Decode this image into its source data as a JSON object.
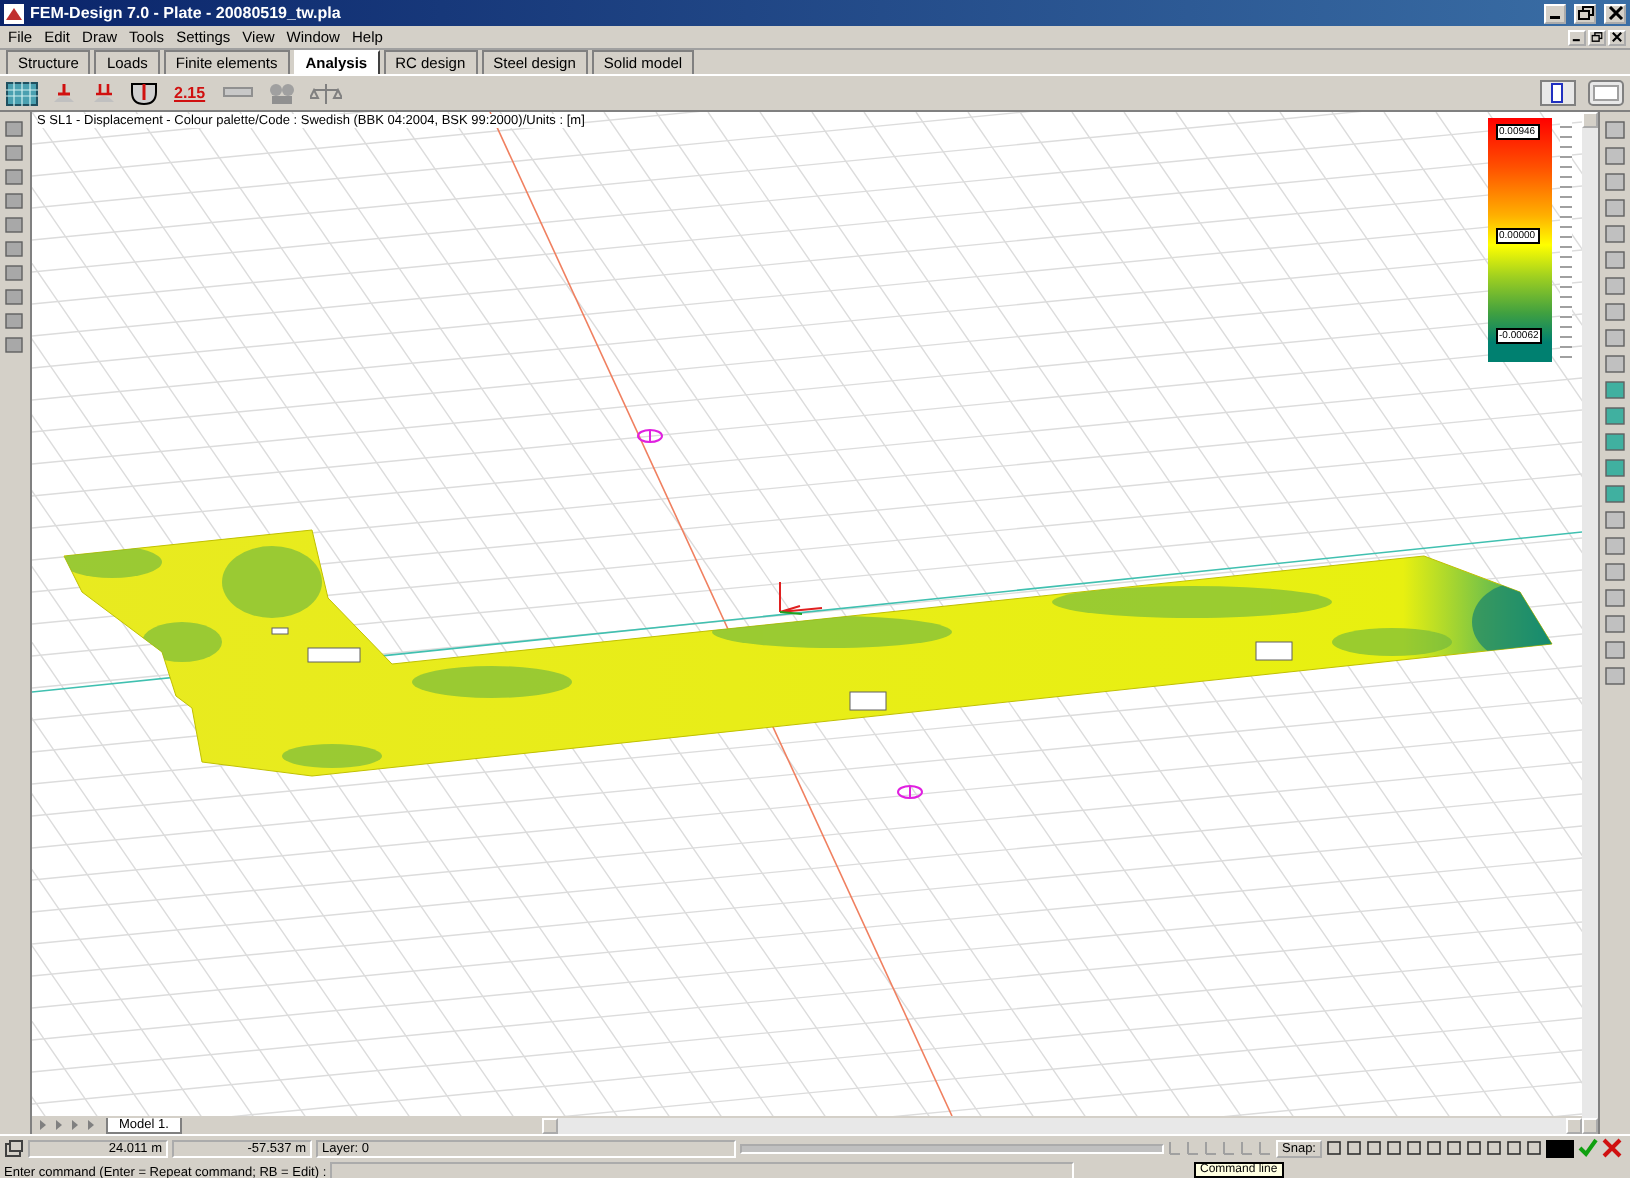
{
  "window": {
    "title": "FEM-Design 7.0 - Plate - 20080519_tw.pla"
  },
  "menu": [
    "File",
    "Edit",
    "Draw",
    "Tools",
    "Settings",
    "View",
    "Window",
    "Help"
  ],
  "tabs": [
    {
      "label": "Structure",
      "selected": false
    },
    {
      "label": "Loads",
      "selected": false
    },
    {
      "label": "Finite elements",
      "selected": false
    },
    {
      "label": "Analysis",
      "selected": true
    },
    {
      "label": "RC design",
      "selected": false
    },
    {
      "label": "Steel design",
      "selected": false
    },
    {
      "label": "Solid model",
      "selected": false
    }
  ],
  "toolbar": {
    "result_value": "2.15"
  },
  "viewport": {
    "caption": "S SL1 - Displacement - Colour palette/Code : Swedish (BBK 04:2004, BSK 99:2000)/Units : [m]",
    "legend": [
      "0.00946",
      "0.00000",
      "-0.00062"
    ],
    "model_tab": "Model 1."
  },
  "status_bar": {
    "x": "24.011 m",
    "y": "-57.537 m",
    "layer": "Layer: 0",
    "snap": "Snap:"
  },
  "command_line": {
    "prompt": "Enter command (Enter = Repeat command; RB = Edit) :",
    "tooltip": "Command line"
  }
}
